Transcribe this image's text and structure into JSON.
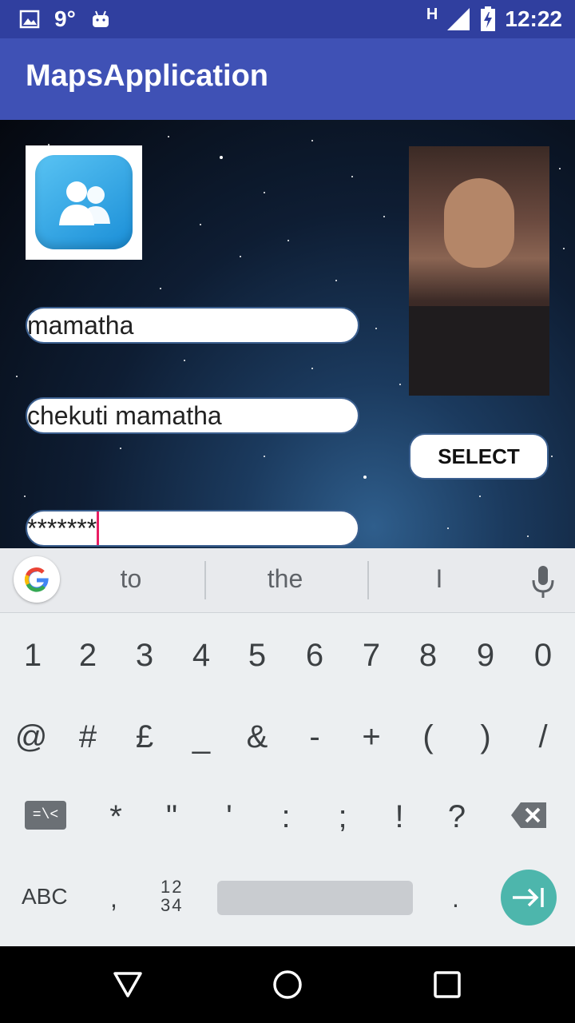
{
  "status_bar": {
    "temperature": "9°",
    "network_type": "H",
    "time": "12:22",
    "icons": [
      "image-icon",
      "android-icon",
      "signal-icon",
      "battery-charging-icon"
    ]
  },
  "app_bar": {
    "title": "MapsApplication"
  },
  "form": {
    "first_field_value": "mamatha",
    "second_field_value": "chekuti mamatha",
    "password_field_value": "*******",
    "select_button_label": "SELECT"
  },
  "keyboard": {
    "suggestions": [
      "to",
      "the",
      "I"
    ],
    "row1": [
      "1",
      "2",
      "3",
      "4",
      "5",
      "6",
      "7",
      "8",
      "9",
      "0"
    ],
    "row2": [
      "@",
      "#",
      "£",
      "_",
      "&",
      "-",
      "+",
      "(",
      ")",
      "/"
    ],
    "row3": [
      "*",
      "\"",
      "'",
      ":",
      ";",
      "!",
      "?"
    ],
    "symbols_key_label": "=\\<",
    "abc_label": "ABC",
    "comma_label": ",",
    "numbers_label_top": "12",
    "numbers_label_bottom": "34",
    "period_label": "."
  },
  "colors": {
    "status_bar": "#303f9f",
    "app_bar": "#3f51b5",
    "enter_key": "#4db6ac",
    "cursor": "#e91e63"
  }
}
